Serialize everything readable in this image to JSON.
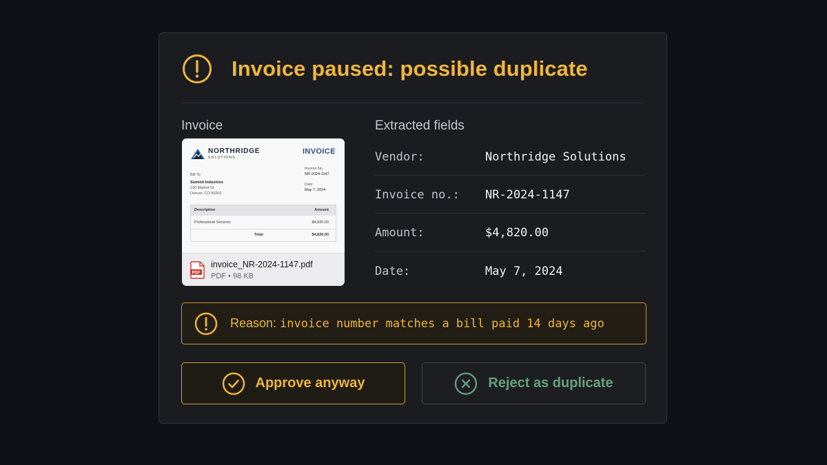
{
  "dialog": {
    "title": "Invoice paused: possible duplicate",
    "invoice_label": "Invoice",
    "fields_label": "Extracted fields"
  },
  "preview": {
    "brand": "NORTHRIDGE",
    "brand_sub": "SOLUTIONS",
    "doc_title": "INVOICE",
    "bill_to_label": "Bill To:",
    "bill_to_name": "Summit Industries",
    "bill_to_addr1": "100 Market St.",
    "bill_to_addr2": "Denver, CO 80202",
    "invoice_no_label": "Invoice No.",
    "invoice_no": "NR-2024-1147",
    "date_label": "Date",
    "date": "May 7, 2024",
    "col_description": "Description",
    "col_amount": "Amount",
    "line_desc": "Professional Services",
    "line_amount": "$4,820.00",
    "total_label": "Total",
    "total_amount": "$4,820.00",
    "file_name": "invoice_NR-2024-1147.pdf",
    "file_meta": "PDF • 98 KB",
    "pdf_badge": "PDF"
  },
  "fields": [
    {
      "key": "Vendor:",
      "value": "Northridge Solutions"
    },
    {
      "key": "Invoice no.:",
      "value": "NR-2024-1147"
    },
    {
      "key": "Amount:",
      "value": "$4,820.00"
    },
    {
      "key": "Date:",
      "value": "May 7, 2024"
    }
  ],
  "reason": {
    "prefix": "Reason:",
    "text": "invoice number matches a bill paid 14 days ago"
  },
  "actions": {
    "approve_label": "Approve anyway",
    "reject_label": "Reject as duplicate"
  },
  "colors": {
    "accent_warning": "#f0b63b",
    "reject_green": "#66a27c",
    "background": "#101116",
    "card": "#1b1c20"
  },
  "icons": {
    "header": "warning-circle-icon",
    "reason": "warning-circle-icon",
    "approve": "check-circle-icon",
    "reject": "x-circle-icon",
    "file": "pdf-file-icon"
  }
}
